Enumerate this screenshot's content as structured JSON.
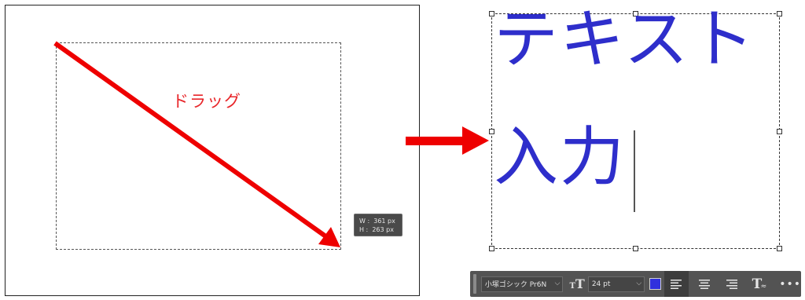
{
  "left_panel": {
    "drag_label": "ドラッグ",
    "tooltip": {
      "width_line": "W :  361 px",
      "height_line": "H :  263 px"
    }
  },
  "right_panel": {
    "text_line1": "テキスト",
    "text_line2": "入力",
    "text_color": "#2e2ecb"
  },
  "options_bar": {
    "font_family": "小塚ゴシック Pr6N",
    "font_size": "24 pt",
    "size_icon": "T",
    "color_swatch": "#3030dd",
    "align_buttons": [
      "align-left",
      "align-center",
      "align-right"
    ],
    "active_align": "align-left",
    "warp_icon": "T",
    "more_label": "•••"
  },
  "colors": {
    "arrow_red": "#ee0000",
    "toolbar_bg": "#535353"
  }
}
